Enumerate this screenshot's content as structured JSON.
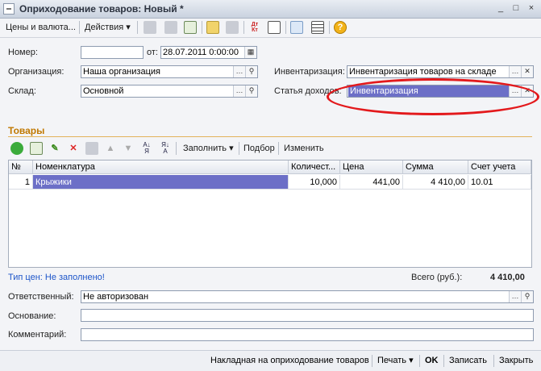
{
  "window": {
    "title": "Оприходование товаров: Новый *",
    "controls": [
      "_",
      "□",
      "×"
    ]
  },
  "toolbar": {
    "prices_label": "Цены и валюта...",
    "actions_label": "Действия",
    "icons": [
      "post-icon",
      "refresh-icon",
      "copy-doc-icon",
      "fill-icon",
      "structure-icon",
      "dt-kt-icon",
      "report-icon",
      "filter-icon",
      "list-icon",
      "help-icon"
    ],
    "dt_kt_text": "Дт Кт",
    "help_text": "?"
  },
  "header": {
    "number_label": "Номер:",
    "number_value": "",
    "from_label": "от:",
    "date_value": "28.07.2011  0:00:00",
    "org_label": "Организация:",
    "org_value": "Наша организация",
    "warehouse_label": "Склад:",
    "warehouse_value": "Основной",
    "inventory_label": "Инвентаризация:",
    "inventory_value": "Инвентаризация товаров на складе",
    "income_label": "Статья доходов:",
    "income_value": "Инвентаризация"
  },
  "goods": {
    "section_title": "Товары",
    "fill_label": "Заполнить",
    "selection_label": "Подбор",
    "change_label": "Изменить",
    "columns": [
      "№",
      "Номенклатура",
      "Количест...",
      "Цена",
      "Сумма",
      "Счет учета"
    ],
    "rows": [
      {
        "n": "1",
        "item": "Крыжики",
        "qty": "10,000",
        "price": "441,00",
        "sum": "4 410,00",
        "account": "10.01"
      }
    ]
  },
  "summary": {
    "price_type_text": "Тип цен: Не заполнено!",
    "total_label": "Всего (руб.):",
    "total_value": "4 410,00"
  },
  "footer_fields": {
    "responsible_label": "Ответственный:",
    "responsible_value": "Не авторизован",
    "basis_label": "Основание:",
    "basis_value": "",
    "comment_label": "Комментарий:",
    "comment_value": ""
  },
  "bottombar": {
    "invoice_label": "Накладная на оприходование товаров",
    "print_label": "Печать",
    "ok_label": "OK",
    "save_label": "Записать",
    "close_label": "Закрыть"
  },
  "colors": {
    "selection": "#6c6fc7",
    "section_title": "#c07800",
    "link_blue": "#1d55c9",
    "annotation_red": "#e3191c"
  }
}
